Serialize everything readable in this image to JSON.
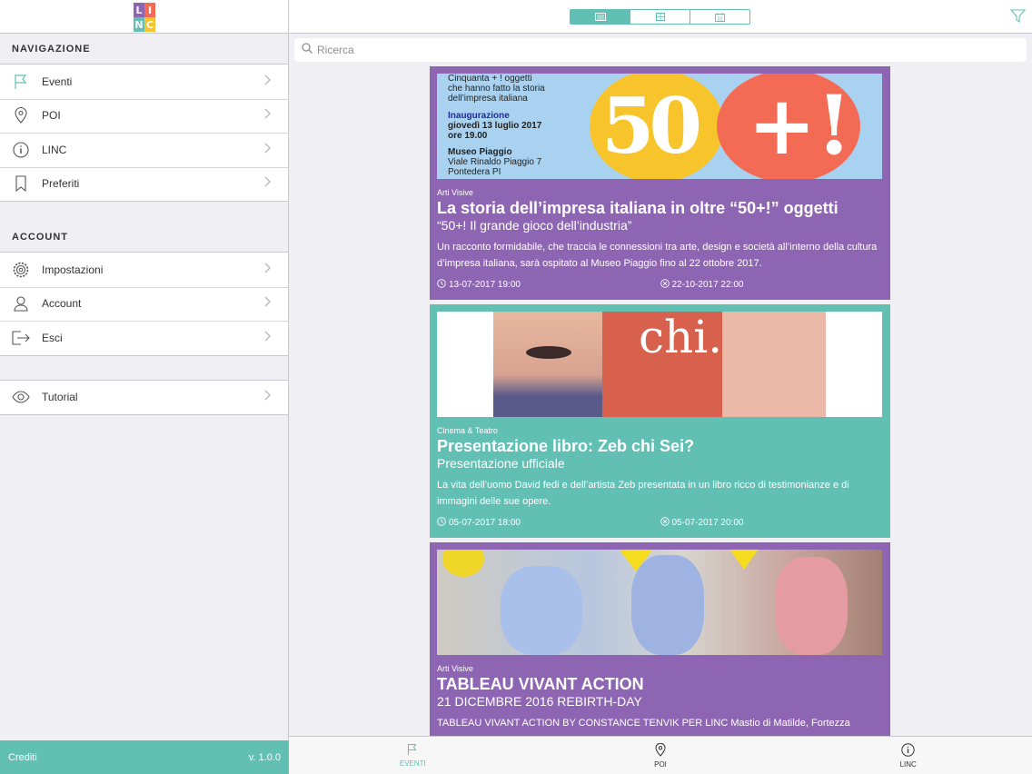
{
  "app": {
    "logo_letters": [
      "L",
      "I",
      "N",
      "C"
    ],
    "logo_colors": [
      "#8e65b2",
      "#f36b55",
      "#61bfb4",
      "#f7c42b"
    ]
  },
  "sidebar": {
    "nav_header": "NAVIGAZIONE",
    "nav_items": [
      {
        "label": "Eventi",
        "icon": "flag-icon"
      },
      {
        "label": "POI",
        "icon": "map-pin-icon"
      },
      {
        "label": "LINC",
        "icon": "info-icon"
      },
      {
        "label": "Preferiti",
        "icon": "bookmark-icon"
      }
    ],
    "account_header": "ACCOUNT",
    "account_items": [
      {
        "label": "Impostazioni",
        "icon": "gear-icon"
      },
      {
        "label": "Account",
        "icon": "user-icon"
      },
      {
        "label": "Esci",
        "icon": "logout-icon"
      }
    ],
    "extra_items": [
      {
        "label": "Tutorial",
        "icon": "eye-icon"
      }
    ],
    "footer": {
      "credits": "Crediti",
      "version": "v. 1.0.0"
    }
  },
  "topbar": {
    "segments": [
      "list-view-icon",
      "grid-view-icon",
      "calendar-view-icon"
    ],
    "active_segment": 0
  },
  "search": {
    "placeholder": "Ricerca"
  },
  "events": [
    {
      "category": "Arti Visive",
      "title": "La storia dell’impresa italiana in oltre “50+!” oggetti",
      "subtitle": "“50+! Il grande gioco dell’industria”",
      "description": "Un racconto formidabile, che traccia le connessioni tra arte, design e società all’interno della cultura d’impresa italiana, sarà ospitato al Museo Piaggio fino al 22 ottobre 2017.",
      "start": "13-07-2017 19:00",
      "end": "22-10-2017 22:00",
      "color": "#8e65b2",
      "poster": {
        "lines": [
          "Cinquanta + ! oggetti",
          "che hanno fatto la storia",
          "dell’impresa italiana"
        ],
        "inaug": [
          "Inaugurazione",
          "giovedì 13 luglio 2017",
          "ore 19.00"
        ],
        "venue": [
          "Museo Piaggio",
          "Viale Rinaldo Piaggio 7",
          "Pontedera PI"
        ],
        "number": "50",
        "sign": "+!"
      }
    },
    {
      "category": "Cinema & Teatro",
      "title": "Presentazione libro: Zeb chi Sei?",
      "subtitle": "Presentazione ufficiale",
      "description": "La vita dell’uomo David fedi e dell’artista Zeb presentata in un libro ricco di testimonianze e di immagini delle sue opere.",
      "start": "05-07-2017 18:00",
      "end": "05-07-2017 20:00",
      "color": "#61bfb4",
      "poster": {
        "word": "chi."
      }
    },
    {
      "category": "Arti Visive",
      "title": "TABLEAU VIVANT ACTION",
      "subtitle": "21 DICEMBRE 2016 REBIRTH-DAY",
      "description": "TABLEAU VIVANT ACTION BY CONSTANCE TENVIK PER LINC Mastio di Matilde, Fortezza",
      "color": "#8e65b2"
    }
  ],
  "tabbar": [
    {
      "label": "EVENTI",
      "icon": "flag-icon",
      "active": true
    },
    {
      "label": "POI",
      "icon": "map-pin-icon",
      "active": false
    },
    {
      "label": "LINC",
      "icon": "info-icon",
      "active": false
    }
  ]
}
